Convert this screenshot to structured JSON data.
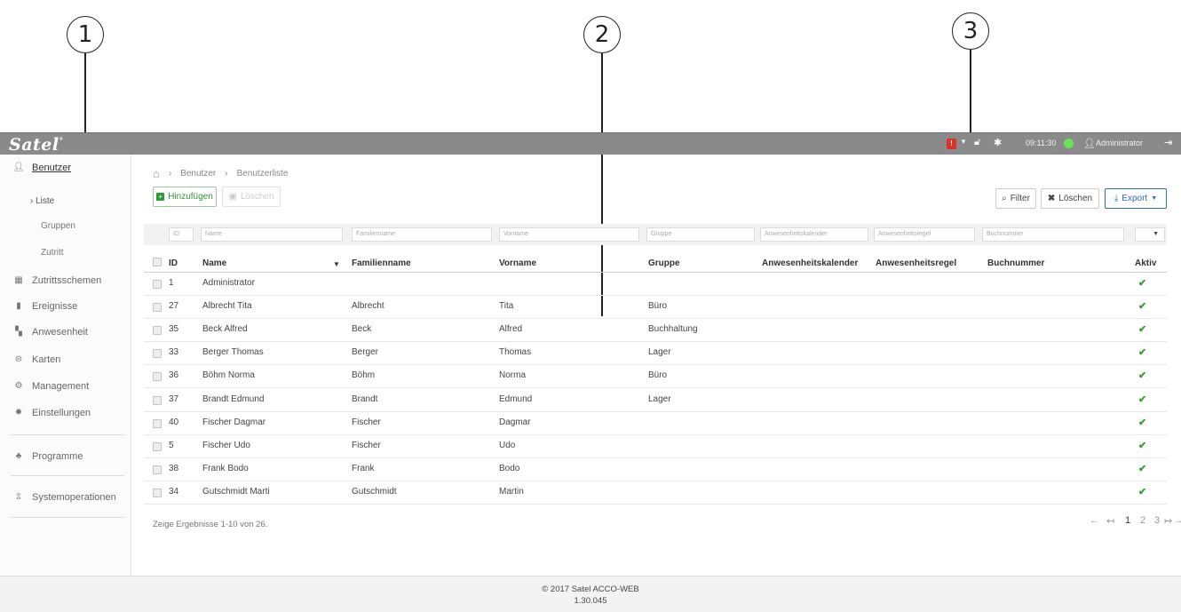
{
  "callouts": [
    "1",
    "2",
    "3"
  ],
  "app": {
    "logo": "Satel",
    "logo_mark": "°"
  },
  "topbar": {
    "alarm_label": "!",
    "time": "09:11:30",
    "user": "Administrator",
    "status_color": "#6ce05a"
  },
  "sidebar": {
    "users": "Benutzer",
    "list": "Liste",
    "groups": "Gruppen",
    "access": "Zutritt",
    "items": [
      "Zutrittsschemen",
      "Ereignisse",
      "Anwesenheit",
      "Karten",
      "Management",
      "Einstellungen"
    ],
    "programs": "Programme",
    "sysops": "Systemoperationen"
  },
  "breadcrumb": [
    "Benutzer",
    "Benutzerliste"
  ],
  "toolbar": {
    "add": "Hinzufügen",
    "delete_disabled": "Löschen",
    "filter": "Filter",
    "delete": "Löschen",
    "export": "Export"
  },
  "filters": [
    "ID",
    "Name",
    "Familienname",
    "Vorname",
    "Gruppe",
    "Anwesenheitskalender",
    "Anwesenheitsregel",
    "Buchnummer"
  ],
  "table": {
    "headers": [
      "ID",
      "Name",
      "Familienname",
      "Vorname",
      "Gruppe",
      "Anwesenheitskalender",
      "Anwesenheitsregel",
      "Buchnummer",
      "Aktiv"
    ],
    "rows": [
      [
        "1",
        "Administrator",
        "",
        "",
        ""
      ],
      [
        "27",
        "Albrecht Tita",
        "Albrecht",
        "Tita",
        "Büro"
      ],
      [
        "35",
        "Beck Alfred",
        "Beck",
        "Alfred",
        "Buchhaltung"
      ],
      [
        "33",
        "Berger Thomas",
        "Berger",
        "Thomas",
        "Lager"
      ],
      [
        "36",
        "Böhm Norma",
        "Böhm",
        "Norma",
        "Büro"
      ],
      [
        "37",
        "Brandt Edmund",
        "Brandt",
        "Edmund",
        "Lager"
      ],
      [
        "40",
        "Fischer Dagmar",
        "Fischer",
        "Dagmar",
        ""
      ],
      [
        "5",
        "Fischer Udo",
        "Fischer",
        "Udo",
        ""
      ],
      [
        "38",
        "Frank Bodo",
        "Frank",
        "Bodo",
        ""
      ],
      [
        "34",
        "Gutschmidt Marti",
        "Gutschmidt",
        "Martin",
        ""
      ]
    ]
  },
  "results": "Zeige Ergebnisse 1-10 von 26.",
  "pager": [
    "←",
    "↤",
    "1",
    "2",
    "3",
    "↦",
    "→"
  ],
  "footer": {
    "line1": "© 2017 Satel ACCO-WEB",
    "line2": "1.30.045"
  }
}
